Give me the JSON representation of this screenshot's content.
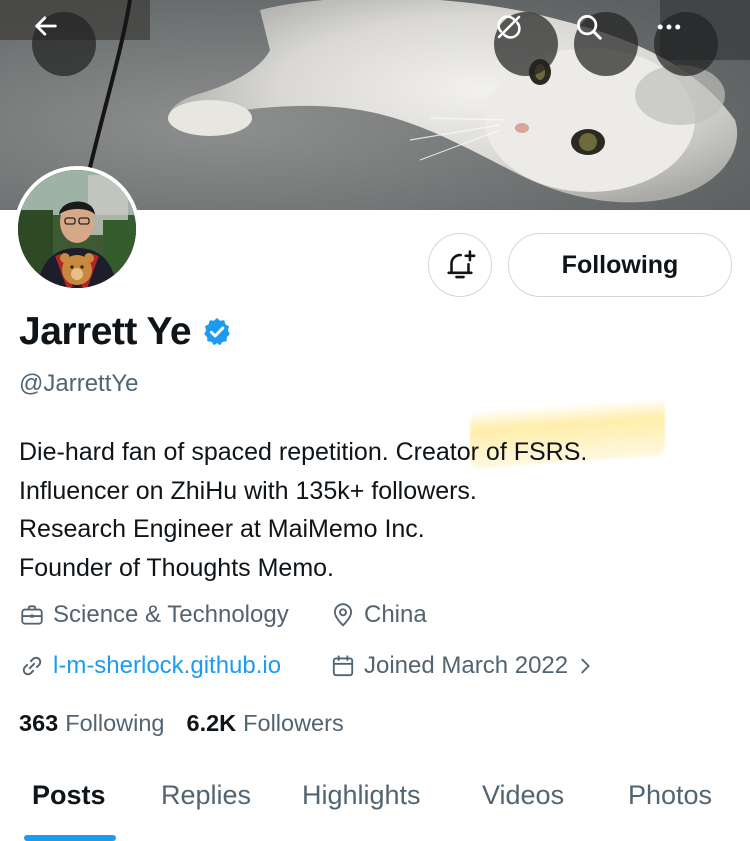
{
  "header": {
    "back_icon": "arrow-left-icon",
    "nocache_icon": "sync-slash-icon",
    "search_icon": "search-icon",
    "more_icon": "more-horizontal-icon"
  },
  "profile": {
    "name": "Jarrett Ye",
    "handle": "@JarrettYe",
    "verified": true,
    "bio": [
      "Die-hard fan of spaced repetition. Creator of FSRS.",
      "Influencer on ZhiHu with 135k+ followers.",
      "Research Engineer at MaiMemo Inc.",
      "Founder of Thoughts Memo."
    ],
    "category": "Science & Technology",
    "location": "China",
    "website": "l-m-sherlock.github.io",
    "joined": "Joined March 2022"
  },
  "actions": {
    "notify_icon": "bell-plus-icon",
    "following_label": "Following"
  },
  "stats": {
    "following_count": "363",
    "following_label": "Following",
    "followers_count": "6.2K",
    "followers_label": "Followers"
  },
  "tabs": [
    {
      "label": "Posts",
      "active": true
    },
    {
      "label": "Replies",
      "active": false
    },
    {
      "label": "Highlights",
      "active": false
    },
    {
      "label": "Videos",
      "active": false
    },
    {
      "label": "Photos",
      "active": false
    }
  ],
  "colors": {
    "accent": "#1d9bf0",
    "text_primary": "#0f1419",
    "text_secondary": "#536471",
    "border": "#cfd9de",
    "highlight": "#ffe066"
  }
}
